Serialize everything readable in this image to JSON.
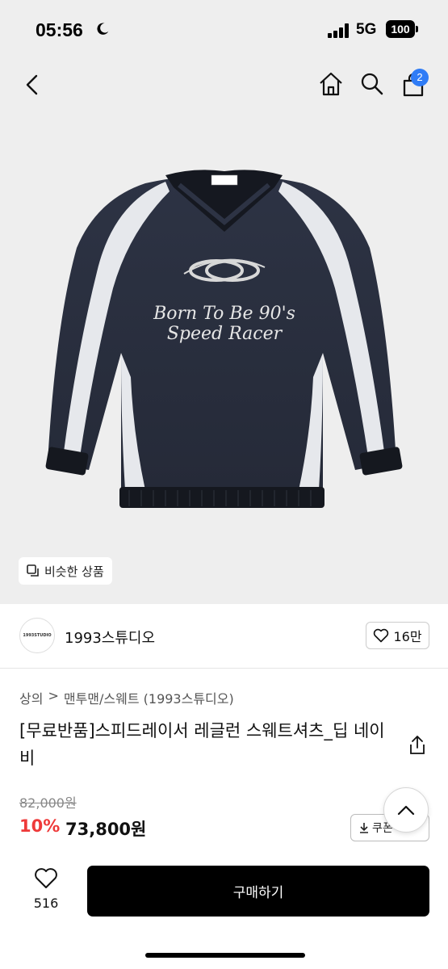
{
  "status_bar": {
    "time": "05:56",
    "network": "5G",
    "battery": "100"
  },
  "nav": {
    "cart_count": "2"
  },
  "hero": {
    "garment_text_line1": "Born To Be 90's",
    "garment_text_line2": "Speed Racer",
    "similar_label": "비슷한 상품"
  },
  "brand": {
    "logo_text": "1993STUDIO",
    "name": "1993스튜디오",
    "likes": "16만"
  },
  "breadcrumb": {
    "level1": "상의",
    "separator": ">",
    "level2": "맨투맨/스웨트 (1993스튜디오)"
  },
  "product": {
    "title": "[무료반품]스피드레이서 레글런 스웨트셔츠_딥 네이비",
    "original_price": "82,000원",
    "discount": "10%",
    "price": "73,800원",
    "coupon_label": "쿠폰"
  },
  "bottom": {
    "wish_count": "516",
    "buy_label": "구매하기"
  }
}
